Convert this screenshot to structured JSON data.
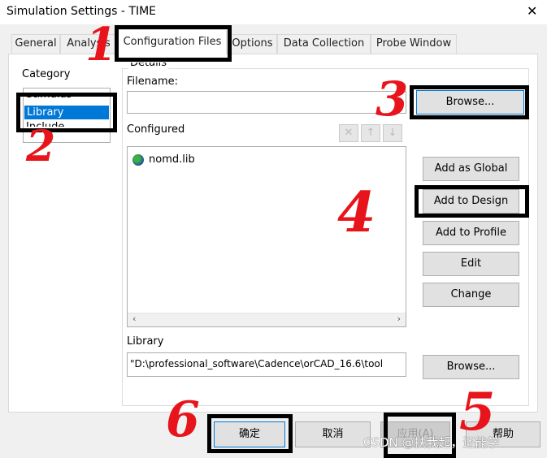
{
  "window": {
    "title": "Simulation Settings - TIME",
    "close_icon": "close-icon"
  },
  "tabs": [
    {
      "label": "General"
    },
    {
      "label": "Analysis"
    },
    {
      "label": "Configuration Files",
      "selected": true
    },
    {
      "label": "Options"
    },
    {
      "label": "Data Collection"
    },
    {
      "label": "Probe Window"
    }
  ],
  "category": {
    "label": "Category",
    "items": [
      {
        "label": "Stimulus"
      },
      {
        "label": "Library",
        "selected": true
      },
      {
        "label": "Include"
      }
    ]
  },
  "details": {
    "label": "Details",
    "filename_label": "Filename:",
    "filename_value": "",
    "browse": "Browse...",
    "configured_label": "Configured",
    "configured_items": [
      {
        "label": "nomd.lib",
        "icon": "globe-icon"
      }
    ],
    "buttons": {
      "add_global": "Add as Global",
      "add_design": "Add to Design",
      "add_profile": "Add to Profile",
      "edit": "Edit",
      "change": "Change"
    },
    "library_label": "Library",
    "library_value": "\"D:\\professional_software\\Cadence\\orCAD_16.6\\tool",
    "library_browse": "Browse..."
  },
  "footer": {
    "ok": "确定",
    "cancel": "取消",
    "apply": "应用(A)",
    "help": "帮助"
  },
  "annotations": [
    "1",
    "2",
    "3",
    "4",
    "5",
    "6"
  ],
  "watermark": "CSDN @扶我起，还能学",
  "colors": {
    "selection": "#0078d7",
    "annotation": "#e8141c"
  }
}
